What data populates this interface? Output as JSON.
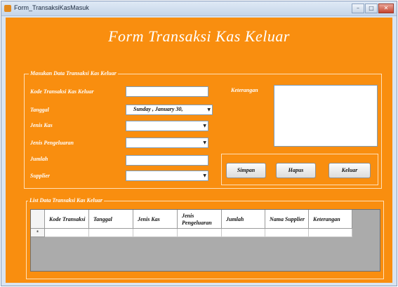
{
  "window": {
    "title": "Form_TransaksiKasMasuk",
    "controls": [
      "–",
      "□",
      "✕"
    ]
  },
  "form": {
    "title": "Form Transaksi Kas Keluar"
  },
  "input_group": {
    "legend": "Masukan Data Transaksi Kas Keluar",
    "kode_label": "Kode Transaksi Kas Keluar",
    "kode_value": "",
    "tanggal_label": "Tanggal",
    "tanggal_value": "Sunday  ,  January  30, ",
    "jenis_kas_label": "Jenis Kas",
    "jenis_kas_value": "",
    "jenis_pengeluaran_label": "Jenis Pengeluaran",
    "jenis_pengeluaran_value": "",
    "jumlah_label": "Jumlah",
    "jumlah_value": "",
    "supplier_label": "Supplier",
    "supplier_value": "",
    "keterangan_label": "Keterangan",
    "keterangan_value": ""
  },
  "buttons": {
    "simpan": "Simpan",
    "hapus": "Hapus",
    "keluar": "Keluar"
  },
  "list_group": {
    "legend": "List Data Transaksi Kas Keluar",
    "columns": [
      "Kode Transaksi",
      "Tanggal",
      "Jenis Kas",
      "Jenis Pengeluaran",
      "Jumlah",
      "Nama Supplier",
      "Keterangan"
    ],
    "new_row_marker": "*"
  },
  "icons": {
    "app": "form-app-icon",
    "dropdown": "chevron-down-icon"
  },
  "colors": {
    "form_background": "#f98e0f",
    "text": "#ffffff",
    "grid_background": "#ababab"
  }
}
